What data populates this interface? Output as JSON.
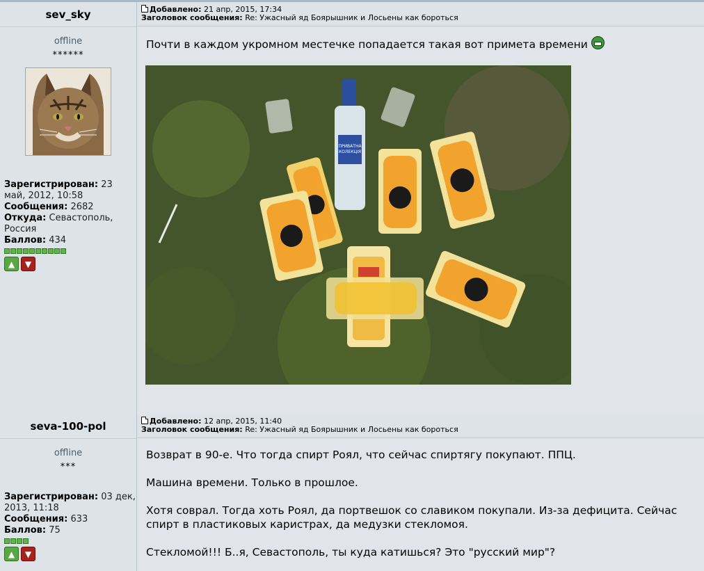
{
  "posts": [
    {
      "username": "sev_sky",
      "added_label": "Добавлено:",
      "added_date": "21 апр, 2015, 17:34",
      "subject_label": "Заголовок сообщения:",
      "subject": "Re: Ужасный яд Боярышник и Лосьены как бороться",
      "status": "offline",
      "stars": "******",
      "reg_label": "Зарегистрирован:",
      "reg_value": "23 май, 2012, 10:58",
      "msgs_label": "Сообщения:",
      "msgs_value": "2682",
      "from_label": "Откуда:",
      "from_value": "Севастополь, Россия",
      "points_label": "Баллов:",
      "points_value": "434",
      "rating_squares": 10,
      "text": "Почти в каждом укромном местечке попадается такая вот примета времени",
      "emoticon": "grin-icon",
      "image_labels": {
        "bottle": "ПРИВАТНА КОЛЕКЦІЯ"
      }
    },
    {
      "username": "seva-100-pol",
      "added_label": "Добавлено:",
      "added_date": "12 апр, 2015, 11:40",
      "subject_label": "Заголовок сообщения:",
      "subject": "Re: Ужасный яд Боярышник и Лосьены как бороться",
      "status": "offline",
      "stars": "***",
      "reg_label": "Зарегистрирован:",
      "reg_value": "03 дек, 2013, 11:18",
      "msgs_label": "Сообщения:",
      "msgs_value": "633",
      "points_label": "Баллов:",
      "points_value": "75",
      "rating_squares": 4,
      "paragraphs": [
        "Возврат в 90-е. Что тогда спирт Роял, что сейчас спиртягу покупают. ППЦ.",
        "Машина времени. Только в прошлое.",
        "Хотя соврал. Тогда хоть Роял, да портвешок со славиком покупали. Из-за дефицита. Сейчас спирт в пластиковых каристрах, да медузки стекломоя.",
        "Стекломой!!! Б..я, Севастополь, ты куда катишься? Это \"русский мир\"?"
      ]
    }
  ],
  "colors": {
    "bg": "#dee3e7",
    "rating": "#5fb54a",
    "vote_up": "#5aa843",
    "vote_down": "#a5221d"
  }
}
